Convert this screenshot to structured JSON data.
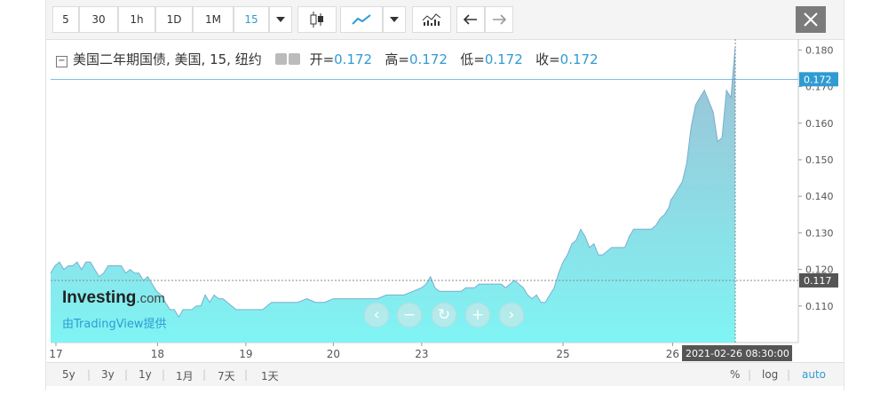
{
  "toolbar": {
    "intervals": [
      "5",
      "30",
      "1h",
      "1D",
      "1M"
    ],
    "selected_interval": "15"
  },
  "legend": {
    "title": "美国二年期国债, 美国, 15, 纽约",
    "open_label": "开=",
    "open_value": "0.172",
    "high_label": "高=",
    "high_value": "0.172",
    "low_label": "低=",
    "low_value": "0.172",
    "close_label": "收=",
    "close_value": "0.172"
  },
  "watermark": {
    "brand": "Investing",
    "brand_suffix": ".com",
    "powered_by": "由TradingView提供"
  },
  "bottom": {
    "ranges": [
      "5y",
      "3y",
      "1y",
      "1月",
      "7天",
      "1天"
    ],
    "scale_options": [
      "%",
      "log",
      "auto"
    ]
  },
  "colors": {
    "accent": "#2f9bd3",
    "area_top": "#9dbfd3",
    "area_bottom": "#80f4f4",
    "line": "#7aaed0"
  },
  "chart_data": {
    "type": "area",
    "ylim": [
      0.1,
      0.183
    ],
    "y_ticks": [
      0.11,
      0.12,
      0.13,
      0.14,
      0.15,
      0.16,
      0.17,
      0.18
    ],
    "y_tick_labels": [
      "0.110",
      "0.120",
      "0.130",
      "0.140",
      "0.150",
      "0.160",
      "0.170",
      "0.180"
    ],
    "current_value": 0.172,
    "current_label": "0.172",
    "crosshair_value": 0.117,
    "crosshair_label": "0.117",
    "crosshair_time_label": "2021-02-26 08:30:00",
    "x_ticks": [
      {
        "label": "17",
        "t": 0.6
      },
      {
        "label": "18",
        "t": 12.1
      },
      {
        "label": "19",
        "t": 22.1
      },
      {
        "label": "20",
        "t": 32.0
      },
      {
        "label": "23",
        "t": 42.0
      },
      {
        "label": "25",
        "t": 58.0
      },
      {
        "label": "26",
        "t": 70.4
      }
    ],
    "x_range": [
      0,
      78
    ],
    "x": [
      0,
      0.5,
      1,
      1.5,
      2,
      2.5,
      3,
      3.5,
      4,
      4.5,
      5,
      5.5,
      6,
      6.5,
      7,
      7.5,
      8,
      8.5,
      9,
      9.5,
      10,
      10.5,
      11,
      11.5,
      12,
      12.5,
      13,
      13.5,
      14,
      14.5,
      15,
      15.5,
      16,
      16.5,
      17,
      17.5,
      18,
      18.5,
      19,
      19.5,
      20,
      20.5,
      21,
      21.5,
      22,
      23,
      24,
      25,
      26,
      27,
      28,
      29,
      30,
      31,
      32,
      33,
      34,
      35,
      36,
      37,
      38,
      39,
      40,
      41,
      42,
      42.5,
      43,
      43.5,
      44,
      44.5,
      45,
      45.5,
      46,
      46.5,
      47,
      47.5,
      48,
      48.5,
      49,
      49.5,
      50,
      50.5,
      51,
      51.5,
      52,
      52.5,
      53,
      53.5,
      54,
      54.5,
      55,
      55.5,
      56,
      56.5,
      57,
      57.5,
      58,
      58.5,
      59,
      59.5,
      60,
      60.5,
      61,
      61.5,
      62,
      62.5,
      63,
      63.5,
      64,
      64.5,
      65,
      65.5,
      66,
      66.5,
      67,
      67.5,
      68,
      68.5,
      69,
      69.5,
      70,
      70.2,
      70.5,
      71,
      71.5,
      72,
      72.5,
      73,
      73.5,
      74,
      74.5,
      75,
      75.5,
      76,
      76.5,
      77,
      77.5
    ],
    "y": [
      0.119,
      0.121,
      0.122,
      0.12,
      0.121,
      0.121,
      0.122,
      0.12,
      0.122,
      0.122,
      0.12,
      0.118,
      0.119,
      0.121,
      0.121,
      0.121,
      0.121,
      0.119,
      0.12,
      0.119,
      0.119,
      0.117,
      0.118,
      0.116,
      0.114,
      0.113,
      0.111,
      0.109,
      0.109,
      0.107,
      0.109,
      0.109,
      0.109,
      0.11,
      0.11,
      0.113,
      0.111,
      0.113,
      0.112,
      0.112,
      0.111,
      0.11,
      0.109,
      0.109,
      0.109,
      0.109,
      0.109,
      0.111,
      0.111,
      0.111,
      0.111,
      0.112,
      0.111,
      0.111,
      0.112,
      0.112,
      0.112,
      0.112,
      0.112,
      0.112,
      0.113,
      0.113,
      0.113,
      0.114,
      0.115,
      0.116,
      0.118,
      0.115,
      0.114,
      0.114,
      0.114,
      0.114,
      0.114,
      0.114,
      0.115,
      0.115,
      0.115,
      0.116,
      0.116,
      0.116,
      0.116,
      0.116,
      0.116,
      0.115,
      0.116,
      0.117,
      0.116,
      0.115,
      0.113,
      0.112,
      0.113,
      0.111,
      0.111,
      0.113,
      0.115,
      0.119,
      0.122,
      0.124,
      0.127,
      0.128,
      0.131,
      0.129,
      0.126,
      0.127,
      0.124,
      0.124,
      0.125,
      0.126,
      0.126,
      0.126,
      0.126,
      0.129,
      0.131,
      0.131,
      0.131,
      0.131,
      0.131,
      0.132,
      0.134,
      0.135,
      0.137,
      0.139,
      0.14,
      0.142,
      0.144,
      0.149,
      0.159,
      0.165,
      0.167,
      0.169,
      0.166,
      0.163,
      0.155,
      0.156,
      0.169,
      0.167,
      0.181,
      0.163,
      0.166,
      0.171,
      0.168,
      0.164,
      0.17,
      0.172,
      0.176,
      0.178,
      0.175,
      0.177,
      0.174,
      0.179,
      0.18,
      0.177,
      0.172
    ]
  }
}
